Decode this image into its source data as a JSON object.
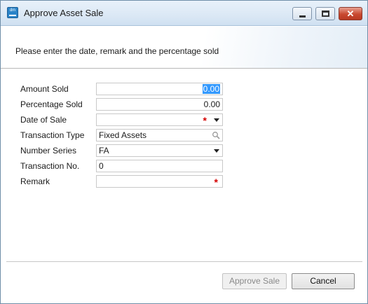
{
  "window": {
    "title": "Approve Asset Sale",
    "icon": "dm-app-icon",
    "icon_text": "dm",
    "controls": [
      "minimize",
      "maximize",
      "close"
    ]
  },
  "header": {
    "instruction": "Please enter the date, remark and the percentage sold"
  },
  "form": {
    "amount_sold": {
      "label": "Amount Sold",
      "value": "0.00",
      "selected": true
    },
    "percentage_sold": {
      "label": "Percentage Sold",
      "value": "0.00"
    },
    "date_of_sale": {
      "label": "Date of Sale",
      "value": "",
      "required": true,
      "dropdown": true
    },
    "transaction_type": {
      "label": "Transaction Type",
      "value": "Fixed Assets",
      "lookup_icon": "search-icon"
    },
    "number_series": {
      "label": "Number Series",
      "value": "FA",
      "dropdown": true
    },
    "transaction_no": {
      "label": "Transaction No.",
      "value": "0"
    },
    "remark": {
      "label": "Remark",
      "value": "",
      "required": true
    }
  },
  "required_marker": "*",
  "buttons": {
    "approve_label": "Approve Sale",
    "approve_enabled": false,
    "cancel_label": "Cancel"
  },
  "colors": {
    "required": "#d40000",
    "selection": "#3399ff",
    "close_button": "#c8482f"
  }
}
